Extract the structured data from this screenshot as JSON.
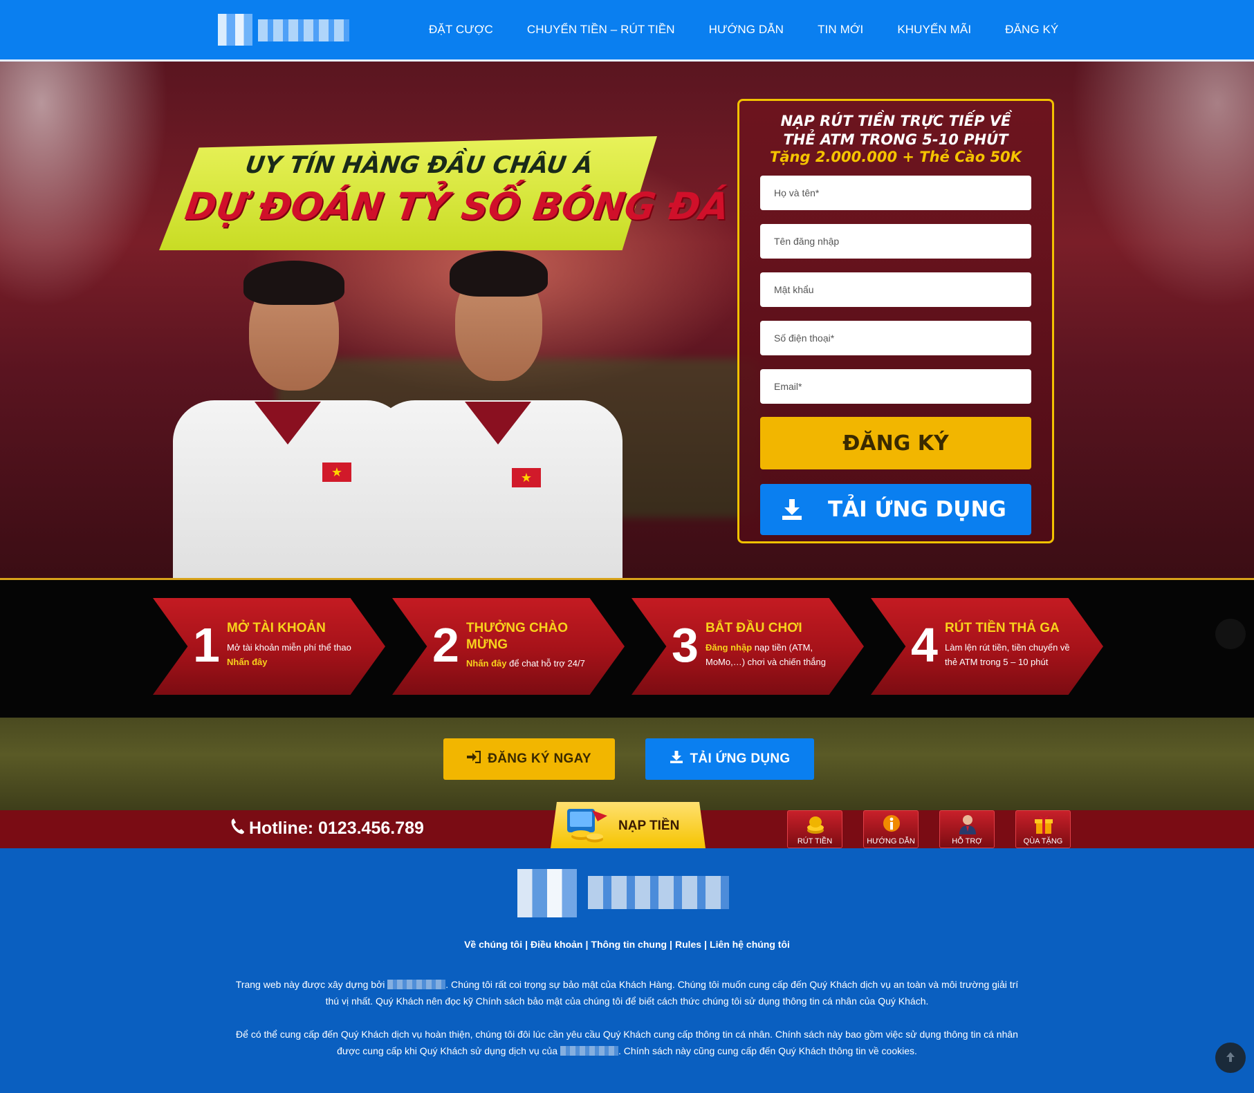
{
  "header": {
    "logo_icon": "logo-mark",
    "nav": [
      {
        "label": "ĐẶT CƯỢC"
      },
      {
        "label": "CHUYỂN TIỀN – RÚT TIỀN"
      },
      {
        "label": "HƯỚNG DẪN"
      },
      {
        "label": "TIN MỚI"
      },
      {
        "label": "KHUYẾN MÃI"
      },
      {
        "label": "ĐĂNG KÝ"
      }
    ]
  },
  "hero": {
    "banner_line1": "UY TÍN HÀNG ĐẦU CHÂU Á",
    "banner_line2": "DỰ ĐOÁN TỶ SỐ BÓNG ĐÁ"
  },
  "form": {
    "title": "NẠP RÚT TIỀN TRỰC TIẾP VỀ THẺ ATM TRONG 5-10 PHÚT",
    "subtitle": "Tặng 2.000.000 + Thẻ Cào 50K",
    "fields": {
      "fullname": {
        "placeholder": "Họ và tên*",
        "value": ""
      },
      "username": {
        "placeholder": "Tên đăng nhập",
        "value": ""
      },
      "password": {
        "placeholder": "Mật khẩu",
        "value": ""
      },
      "phone": {
        "placeholder": "Số điện thoại*",
        "value": ""
      },
      "email": {
        "placeholder": "Email*",
        "value": ""
      }
    },
    "register_label": "ĐĂNG KÝ",
    "app_label": "TẢI ỨNG DỤNG",
    "app_icon": "download-icon"
  },
  "steps": [
    {
      "num": "1",
      "title": "MỞ TÀI KHOẢN",
      "desc": "Mở tài khoản miễn phí thể thao",
      "link": "Nhấn đây"
    },
    {
      "num": "2",
      "title": "THƯỞNG CHÀO MỪNG",
      "link": "Nhấn đây",
      "desc": "để chat hỗ trợ 24/7"
    },
    {
      "num": "3",
      "title": "BẮT ĐẦU CHƠI",
      "link": "Đăng nhập",
      "desc": "nạp tiền (ATM, MoMo,…) chơi và chiến thắng"
    },
    {
      "num": "4",
      "title": "RÚT TIỀN THẢ GA",
      "desc": "Làm lện rút tiền, tiền chuyển về thẻ ATM trong 5 – 10 phút"
    }
  ],
  "cta": {
    "register_now": "ĐĂNG KÝ NGAY",
    "register_icon": "sign-in-icon",
    "download_app": "TẢI ỨNG DỤNG",
    "download_icon": "download-icon"
  },
  "bar": {
    "hotline": "Hotline: 0123.456.789",
    "hotline_icon": "phone-icon",
    "deposit": "NẠP TIỀN",
    "deposit_icon": "coins-icon",
    "shortcuts": [
      {
        "label": "RÚT TIỀN",
        "icon": "withdraw-icon"
      },
      {
        "label": "HƯỚNG DẪN",
        "icon": "guide-icon"
      },
      {
        "label": "HỖ TRỢ",
        "icon": "support-icon"
      },
      {
        "label": "QÙA TẶNG",
        "icon": "gift-icon"
      }
    ]
  },
  "footer": {
    "links": [
      "Về chúng tôi",
      "Điều khoản",
      "Thông tin chung",
      "Rules",
      "Liên hệ chúng tôi"
    ],
    "separator": "|",
    "para1_a": "Trang web này được xây dựng bởi",
    "para1_b": ". Chúng tôi rất coi trọng sự bảo mật của Khách Hàng. Chúng tôi muốn cung cấp đến Quý Khách dịch vụ an toàn và môi trường giải trí thú vị nhất. Quý Khách nên đọc kỹ Chính sách bảo mật của chúng tôi để biết cách thức chúng tôi sử dụng thông tin cá nhân của Quý Khách.",
    "para2_a": "Để có thể cung cấp đến Quý Khách dịch vụ hoàn thiện, chúng tôi đôi lúc cần yêu cầu Quý Khách cung cấp thông tin cá nhân. Chính sách này bao gồm việc sử dụng thông tin cá nhân được cung cấp khi Quý Khách sử dụng dịch vụ của",
    "para2_b": ". Chính sách này cũng cung cấp đến Quý Khách thông tin về cookies."
  },
  "colors": {
    "header_blue": "#0a7ff0",
    "footer_blue": "#0a5fc0",
    "accent_yellow": "#f2b600",
    "step_red": "#c41b22",
    "bar_red": "#7a0c14"
  },
  "scroll_top_icon": "arrow-up-icon"
}
